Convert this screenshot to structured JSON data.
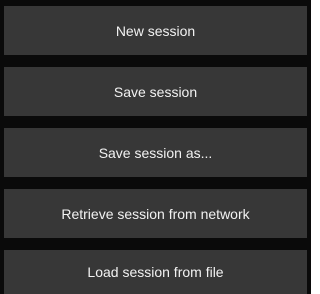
{
  "menu": {
    "items": [
      {
        "label": "New session"
      },
      {
        "label": "Save session"
      },
      {
        "label": "Save session as..."
      },
      {
        "label": "Retrieve session from network"
      },
      {
        "label": "Load session from file"
      }
    ]
  },
  "colors": {
    "background": "#0a0a0a",
    "button": "#373737",
    "text": "#f2f2f2"
  }
}
